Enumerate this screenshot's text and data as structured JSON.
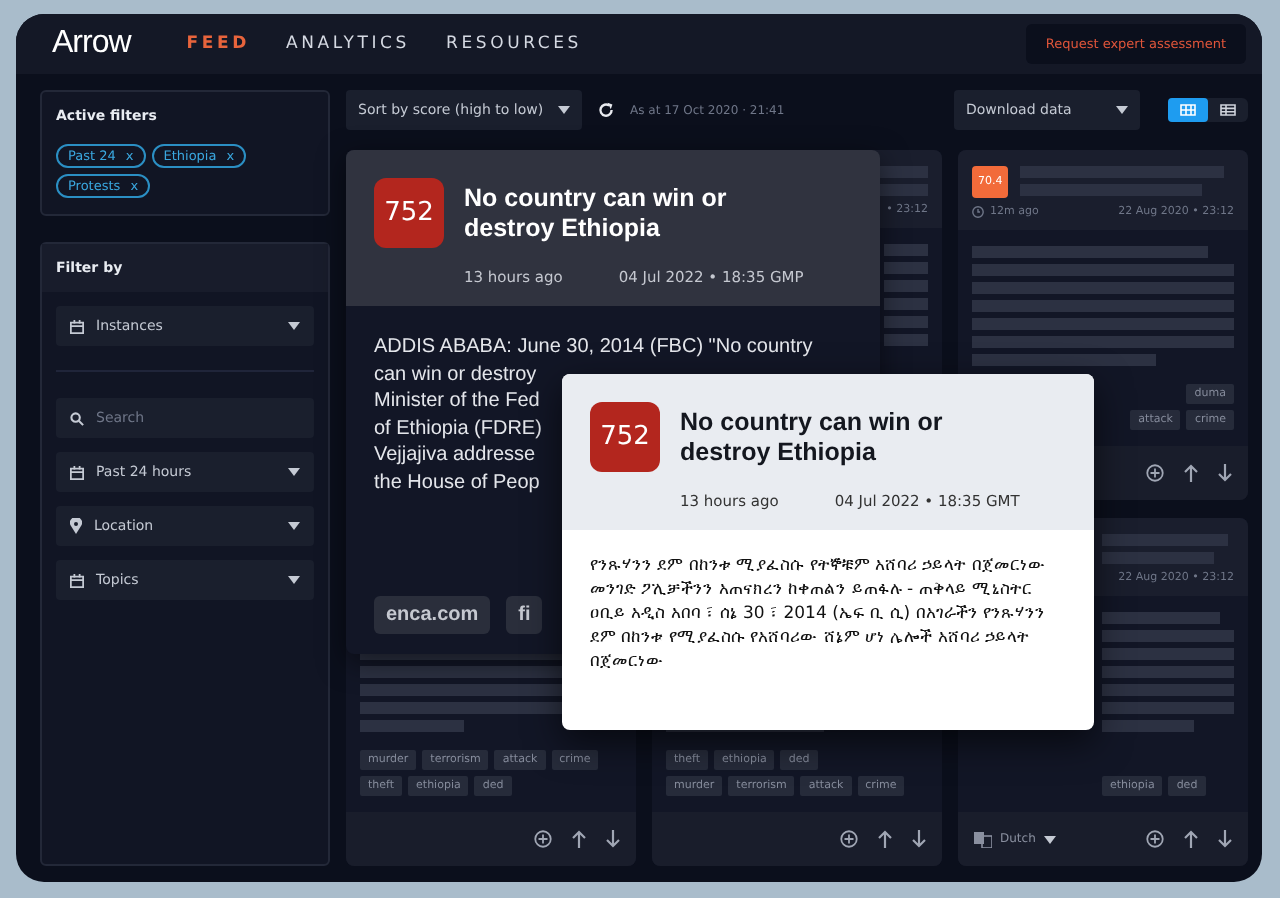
{
  "brand": {
    "name": "Arrow"
  },
  "nav": [
    {
      "label": "FEED",
      "selected": true
    },
    {
      "label": "ANALYTICS",
      "selected": false
    },
    {
      "label": "RESOURCES",
      "selected": false
    }
  ],
  "header_button": "Request expert assessment",
  "active_filters": {
    "title": "Active filters",
    "chips": [
      {
        "label": "Past 24",
        "remove": "x"
      },
      {
        "label": "Ethiopia",
        "remove": "x"
      },
      {
        "label": "Protests",
        "remove": "x"
      }
    ]
  },
  "filter_by": {
    "title": "Filter by",
    "fields": [
      {
        "kind": "select",
        "label": "Instances"
      },
      {
        "kind": "search",
        "placeholder": "Search"
      },
      {
        "kind": "select",
        "label": "Past 24 hours"
      },
      {
        "kind": "place",
        "label": "Location"
      },
      {
        "kind": "select",
        "label": "Topics"
      }
    ]
  },
  "toolbar": {
    "sort": "Sort by score (high to low)",
    "timestamp": "As at 17 Oct 2020 · 21:41",
    "download": "Download data",
    "views": [
      {
        "kind": "grid",
        "selected": true
      },
      {
        "kind": "list",
        "selected": false
      }
    ]
  },
  "columns": [
    {
      "cards": [
        {
          "tags": [
            [
              "murder",
              "terrorism",
              "attack",
              "crime"
            ],
            [
              "theft",
              "ethiopia",
              "ded"
            ]
          ]
        }
      ]
    },
    {
      "cards": [
        {
          "date": "• 23:12",
          "tags": [
            [
              "theft",
              "ethiopia",
              "ded"
            ],
            [
              "murder",
              "terrorism",
              "attack",
              "crime"
            ]
          ]
        }
      ]
    },
    {
      "cards": [
        {
          "score": "70.4",
          "color": "#f26b3a",
          "ago": "12m ago",
          "date": "22 Aug 2020 • 23:12",
          "tags": [
            [
              "duma"
            ],
            [
              "attack",
              "crime"
            ]
          ]
        },
        {
          "date": "22 Aug 2020 • 23:12",
          "tags": [
            [
              "ethiopia",
              "ded"
            ]
          ],
          "language": "Dutch"
        }
      ]
    }
  ],
  "expanded_card": {
    "score": "752",
    "color": "#b3261e",
    "title": "No country can win or destroy Ethiopia",
    "ago": "13 hours ago",
    "date": "04 Jul 2022 • 18:35 GMP",
    "body_lines": [
      "ADDIS ABABA: June 30, 2014 (FBC) \"No country",
      "can win or destroy",
      "Minister of the Fed",
      "of Ethiopia (FDRE)",
      "Vejjajiva addresse",
      "the House of Peop"
    ],
    "sources": [
      "enca.com",
      "fi"
    ]
  },
  "popup": {
    "score": "752",
    "color": "#b3261e",
    "title": "No country can win or destroy Ethiopia",
    "ago": "13 hours ago",
    "date": "04 Jul 2022 • 18:35 GMT",
    "body": "የንጹሃንን ደም በከንቱ ሚያፈስሱ የትኞቹም አሸባሪ ኃይላት በጀመርነው መንገድ ፖሊቻችንን አጠናክረን ከቀጠልን ይጠፋሉ - ጠቅላይ ሚኒስትር ዐቢይ አዲስ አበባ ፣ ሰኔ 30 ፣ 2014 (ኤፍ ቢ ሲ) በአገራችን የንጹሃንን ደም በከንቱ የሚያፈስሱ የአሸባሪው ሸኔም ሆነ ሌሎች አሸባሪ ኃይላት በጀመርነው"
  }
}
